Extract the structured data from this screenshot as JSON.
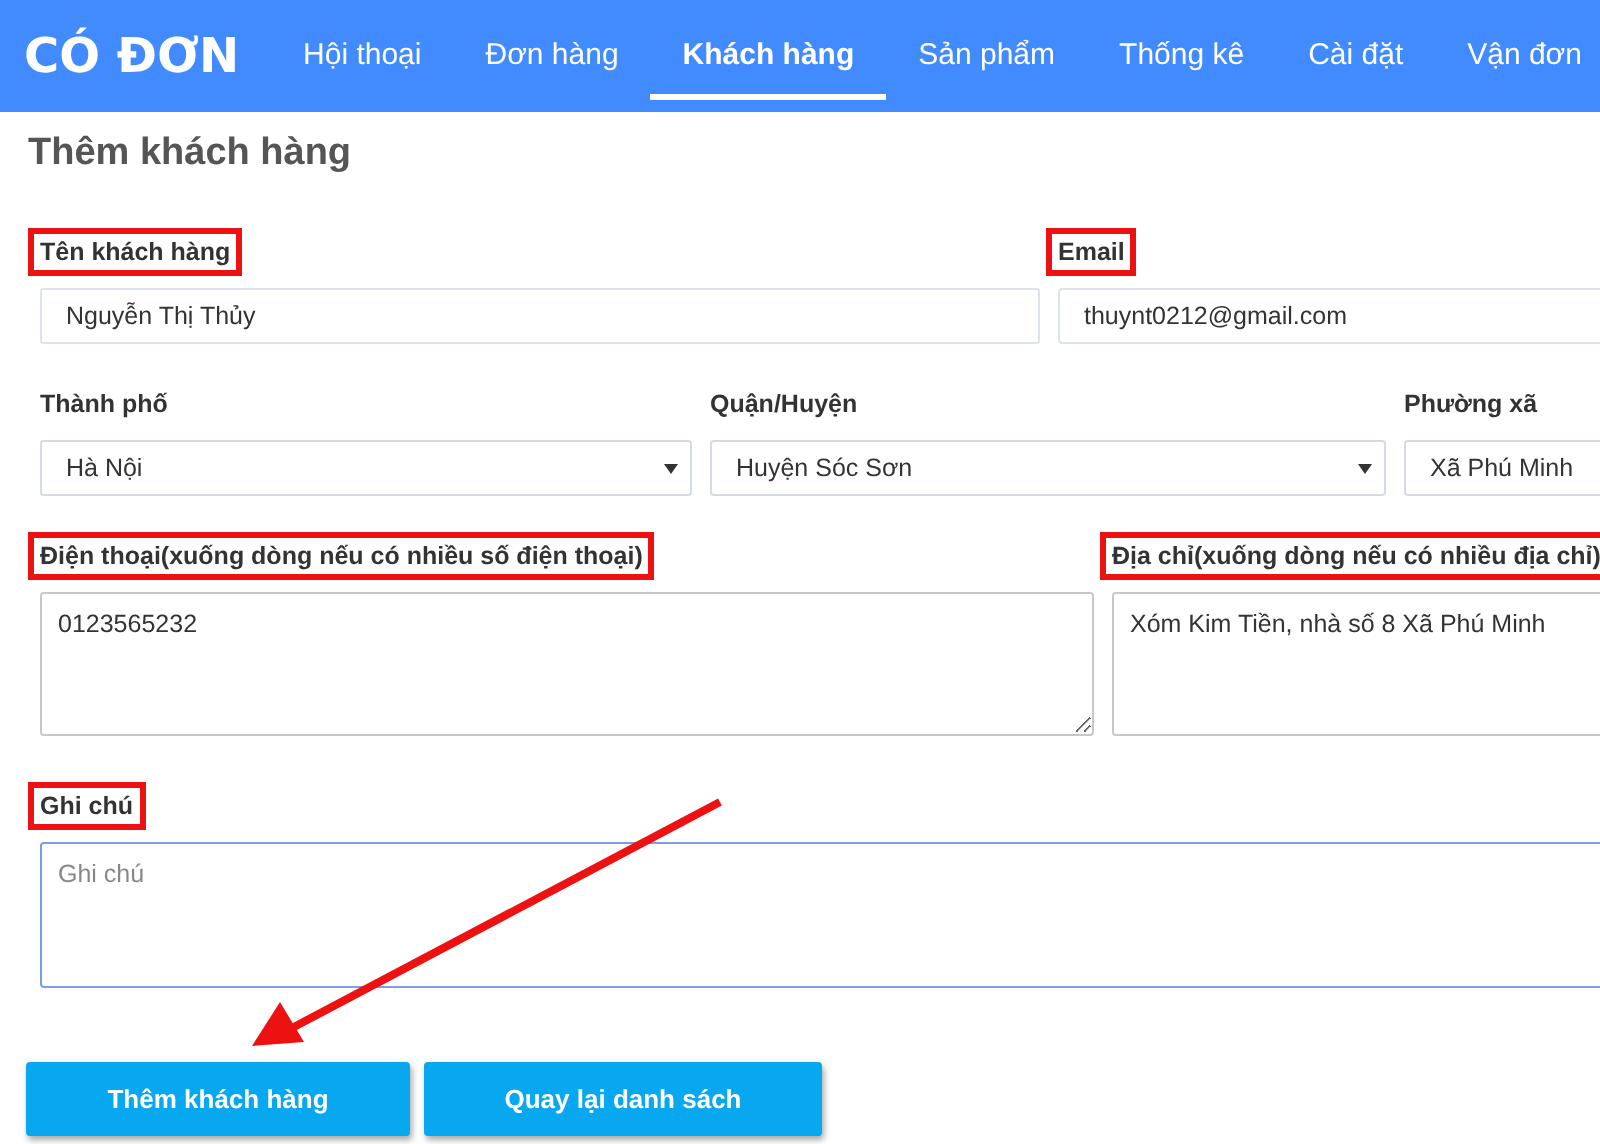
{
  "nav": {
    "logo": "CÓ ĐƠN",
    "tabs": [
      {
        "label": "Hội thoại",
        "selected": false
      },
      {
        "label": "Đơn hàng",
        "selected": false
      },
      {
        "label": "Khách hàng",
        "selected": true
      },
      {
        "label": "Sản phẩm",
        "selected": false
      },
      {
        "label": "Thống kê",
        "selected": false
      },
      {
        "label": "Cài đặt",
        "selected": false
      },
      {
        "label": "Vận đơn",
        "selected": false
      }
    ]
  },
  "page_title": "Thêm khách hàng",
  "form": {
    "rows": [
      [
        {
          "kind": "input",
          "label": "Tên khách hàng",
          "highlighted": true,
          "value": "Nguyễn Thị Thủy",
          "focused": false
        },
        {
          "kind": "input",
          "label": "Email",
          "highlighted": true,
          "value": "thuynt0212@gmail.com",
          "focused": false
        }
      ],
      [
        {
          "kind": "select",
          "label": "Thành phố",
          "highlighted": false,
          "value": "Hà Nội",
          "focused": false
        },
        {
          "kind": "select",
          "label": "Quận/Huyện",
          "highlighted": false,
          "value": "Huyện Sóc Sơn",
          "focused": false
        },
        {
          "kind": "select",
          "label": "Phường xã",
          "highlighted": false,
          "value": "Xã Phú Minh",
          "focused": false
        }
      ],
      [
        {
          "kind": "textarea",
          "label": "Điện thoại(xuống dòng nếu có nhiều số điện thoại)",
          "highlighted": true,
          "value": "0123565232",
          "focused": false
        },
        {
          "kind": "textarea",
          "label": "Địa chỉ(xuống dòng nếu có nhiều địa chỉ)",
          "highlighted": true,
          "value": "Xóm Kim Tiền, nhà số 8 Xã Phú Minh",
          "focused": false
        }
      ],
      [
        {
          "kind": "textarea",
          "label": "Ghi chú",
          "highlighted": true,
          "placeholder": "Ghi chú",
          "focused": true
        }
      ]
    ]
  },
  "buttons": [
    "Thêm khách hàng",
    "Quay lại danh sách"
  ]
}
